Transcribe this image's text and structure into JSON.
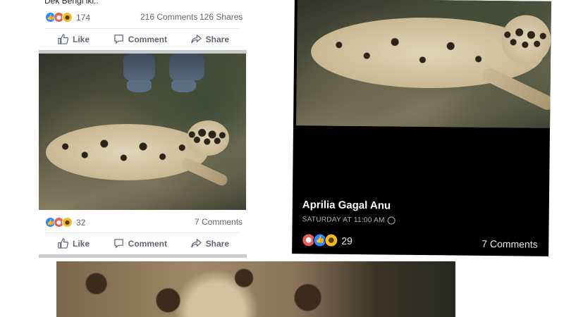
{
  "post": {
    "caption": "Dek Bengi iki..",
    "reaction_count": "174",
    "comments": "216 Comments",
    "shares": "126 Shares",
    "like_label": "Like",
    "comment_label": "Comment",
    "share_label": "Share"
  },
  "photo_post": {
    "reaction_count": "32",
    "comments": "7 Comments",
    "like_label": "Like",
    "comment_label": "Comment",
    "share_label": "Share"
  },
  "right_card": {
    "author": "Aprilia Gagal Anu",
    "timestamp": "SATURDAY AT 11:00 AM",
    "reaction_count": "29",
    "comments": "7 Comments"
  },
  "colors": {
    "like": "#2d88ff",
    "angry": "#e4605a",
    "sad": "#f7b928",
    "text_muted": "#606770",
    "separator": "#c9ccd1"
  },
  "icons": [
    "like-icon",
    "comment-icon",
    "share-icon",
    "globe-icon",
    "like-reaction-icon",
    "angry-reaction-icon",
    "sad-reaction-icon"
  ]
}
